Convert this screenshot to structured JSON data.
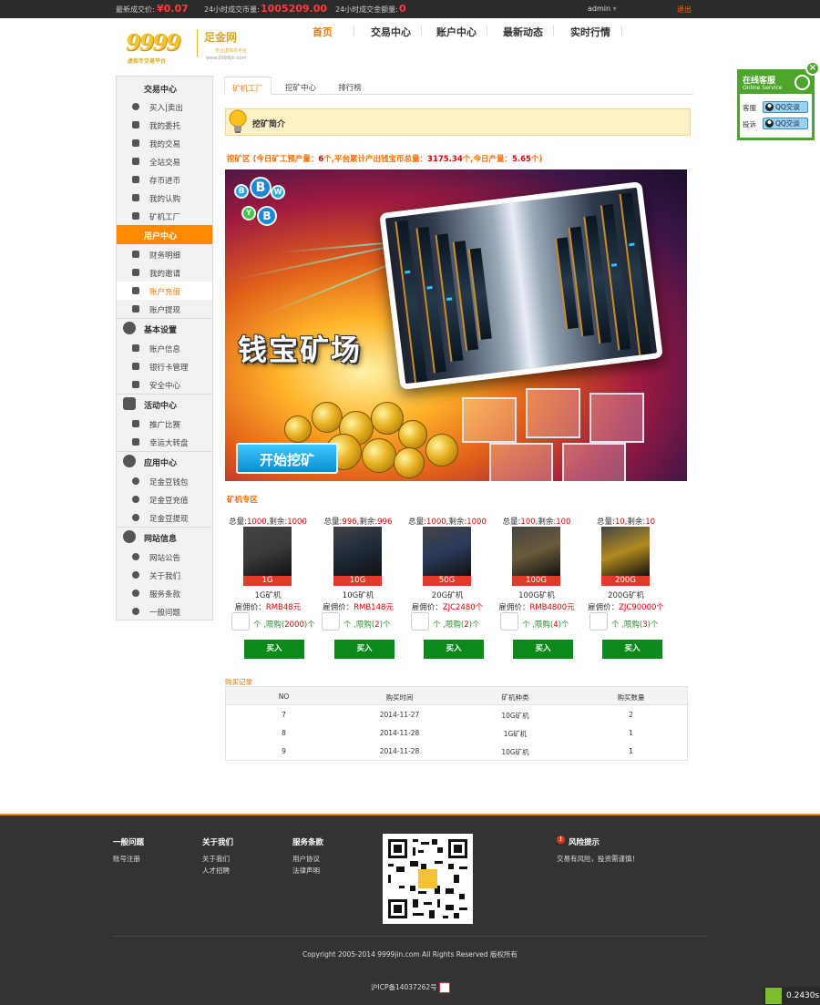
{
  "topbar": {
    "last_price_label": "最新成交价:",
    "last_price": "¥0.07",
    "volume_label": "24小时成交币量:",
    "volume": "1005209.00",
    "amount_label": "24小时成交金额量:",
    "amount": "0",
    "user": "admin",
    "logout": "退出"
  },
  "logo": {
    "mark": "9999",
    "name": "足金网",
    "slogan": "专业虚拟币平台",
    "sub": "虚拟币交易平台",
    "url": "www.9999jin.com"
  },
  "nav": [
    "首页",
    "交易中心",
    "账户中心",
    "最新动态",
    "实时行情"
  ],
  "sidebar": {
    "groups": [
      {
        "title": "交易中心",
        "items": [
          "买入|卖出",
          "我的委托",
          "我的交易",
          "全站交易",
          "存币进币",
          "我的认购",
          "矿机工厂"
        ]
      },
      {
        "title": "用户中心",
        "items": [
          "财务明细",
          "我的邀请",
          "账户充值",
          "账户提现"
        ]
      },
      {
        "title": "基本设置",
        "items": [
          "账户信息",
          "银行卡管理",
          "安全中心"
        ]
      },
      {
        "title": "活动中心",
        "items": [
          "推广比赛",
          "幸运大转盘"
        ]
      },
      {
        "title": "应用中心",
        "items": [
          "足金豆钱包",
          "足金豆充值",
          "足金豆提现"
        ]
      },
      {
        "title": "网站信息",
        "items": [
          "网站公告",
          "关于我们",
          "服务条款",
          "一般问题"
        ]
      }
    ]
  },
  "tabs": [
    "矿机工厂",
    "挖矿中心",
    "排行榜"
  ],
  "intro_title": "挖矿简介",
  "stats": {
    "prefix": "挖矿区 (今日矿工预产量：",
    "v1": "6",
    "mid1": "个,平台累计产出钱宝币总量：",
    "v2": "3175.34",
    "mid2": "个,今日产量：",
    "v3": "5.65",
    "suffix": "个)"
  },
  "banner": {
    "title": "钱宝矿场",
    "button": "开始挖矿",
    "bubbles": [
      "B",
      "B",
      "W",
      "Y",
      "B"
    ]
  },
  "section_title": "矿机专区",
  "products": [
    {
      "total_label": "总量:",
      "total": "1000",
      "remain_label": ",剩余:",
      "remain": "1000",
      "badge": "1G",
      "name": "1G矿机",
      "price_label": "雇佣价：",
      "price": "RMB48元",
      "limit_a": "个 ,限购(",
      "limit": "2000",
      "limit_b": ")个",
      "buy": "买入",
      "color": "#3a3a3a"
    },
    {
      "total_label": "总量:",
      "total": "996",
      "remain_label": ",剩余:",
      "remain": "996",
      "badge": "10G",
      "name": "10G矿机",
      "price_label": "雇佣价：",
      "price": "RMB148元",
      "limit_a": "个 ,限购(",
      "limit": "2",
      "limit_b": ")个",
      "buy": "买入",
      "color": "#1e2a3a"
    },
    {
      "total_label": "总量:",
      "total": "1000",
      "remain_label": ",剩余:",
      "remain": "1000",
      "badge": "50G",
      "name": "20G矿机",
      "price_label": "雇佣价：",
      "price": "ZJC2480个",
      "limit_a": "个 ,限购(",
      "limit": "2",
      "limit_b": ")个",
      "buy": "买入",
      "color": "#2a3a5a"
    },
    {
      "total_label": "总量:",
      "total": "100",
      "remain_label": ",剩余:",
      "remain": "100",
      "badge": "100G",
      "name": "100G矿机",
      "price_label": "雇佣价：",
      "price": "RMB4800元",
      "limit_a": "个 ,限购(",
      "limit": "4",
      "limit_b": ")个",
      "buy": "买入",
      "color": "#6a5a3a"
    },
    {
      "total_label": "总量:",
      "total": "10",
      "remain_label": ",剩余:",
      "remain": "10",
      "badge": "200G",
      "name": "200G矿机",
      "price_label": "雇佣价：",
      "price": "ZJC90000个",
      "limit_a": "个 ,限购(",
      "limit": "3",
      "limit_b": ")个",
      "buy": "买入",
      "color": "#b08a20"
    }
  ],
  "records": {
    "title": "购买记录",
    "headers": [
      "NO",
      "购买时间",
      "矿机种类",
      "购买数量"
    ],
    "rows": [
      [
        "7",
        "2014-11-27",
        "10G矿机",
        "2"
      ],
      [
        "8",
        "2014-11-28",
        "1G矿机",
        "1"
      ],
      [
        "9",
        "2014-11-28",
        "10G矿机",
        "1"
      ]
    ]
  },
  "footer": {
    "cols": [
      {
        "title": "一般问题",
        "links": [
          "账号注册"
        ]
      },
      {
        "title": "关于我们",
        "links": [
          "关于我们",
          "人才招聘"
        ]
      },
      {
        "title": "服务条款",
        "links": [
          "用户协议",
          "法律声明"
        ]
      }
    ],
    "risk_title": "风险提示",
    "risk_text": "交易有风险，投资需谨慎！",
    "copyright": "Copyright 2005-2014 9999jin.com All Rights Reserved 版权所有",
    "icp": "沪ICP备14037262号"
  },
  "service": {
    "title": "在线客服",
    "subtitle": "Online Service",
    "rows": [
      {
        "label": "客服",
        "btn": "QQ交谈"
      },
      {
        "label": "投诉",
        "btn": "QQ交谈"
      }
    ]
  },
  "timer": "0.2430s"
}
